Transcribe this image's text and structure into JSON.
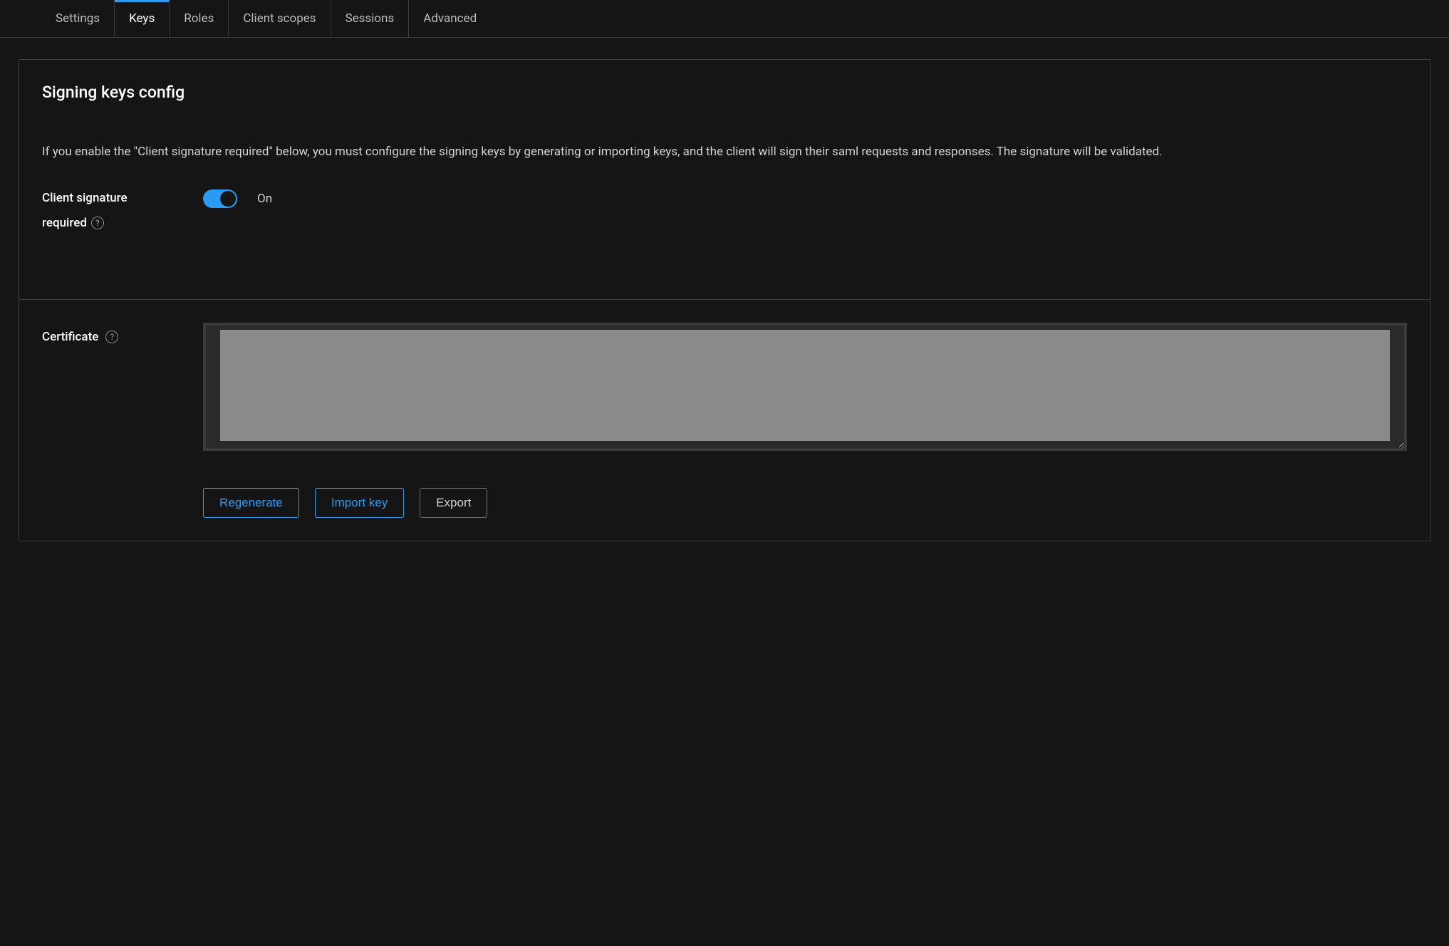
{
  "tabs": {
    "settings": "Settings",
    "keys": "Keys",
    "roles": "Roles",
    "client_scopes": "Client scopes",
    "sessions": "Sessions",
    "advanced": "Advanced",
    "active": "Keys"
  },
  "signing": {
    "title": "Signing keys config",
    "description": "If you enable the \"Client signature required\" below, you must configure the signing keys by generating or importing keys, and the client will sign their saml requests and responses. The signature will be validated.",
    "sig_required_label_line1": "Client signature",
    "sig_required_label_line2": "required",
    "toggle_state": "On"
  },
  "certificate": {
    "label": "Certificate",
    "value": ""
  },
  "buttons": {
    "regenerate": "Regenerate",
    "import_key": "Import key",
    "export": "Export"
  }
}
